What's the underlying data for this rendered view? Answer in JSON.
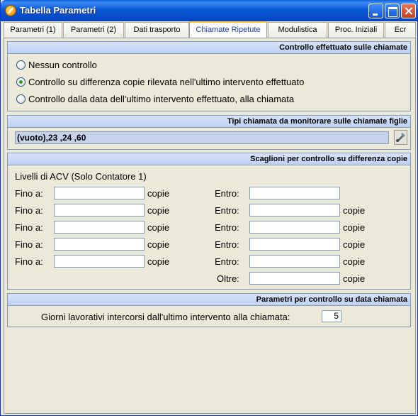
{
  "window": {
    "title": "Tabella Parametri"
  },
  "tabs": [
    "Parametri (1)",
    "Parametri (2)",
    "Dati trasporto",
    "Chiamate Ripetute",
    "Modulistica",
    "Proc. Iniziali",
    "Ecr"
  ],
  "controllo": {
    "header": "Controllo effettuato sulle chiamate",
    "options": [
      "Nessun controllo",
      "Controllo su differenza copie rilevata nell'ultimo intervento effettuato",
      "Controllo dalla data dell'ultimo intervento effettuato, alla chiamata"
    ],
    "selected_index": 1
  },
  "tipi": {
    "header": "Tipi chiamata da monitorare sulle chiamate figlie",
    "value": "(vuoto),23  ,24  ,60"
  },
  "scaglioni": {
    "header": "Scaglioni per controllo su differenza copie",
    "subtitle": "Livelli di ACV (Solo Contatore 1)",
    "fino_label": "Fino a:",
    "entro_label": "Entro:",
    "oltre_label": "Oltre:",
    "copie_label": "copie",
    "rows": [
      {
        "fino": "",
        "entro": ""
      },
      {
        "fino": "",
        "entro": ""
      },
      {
        "fino": "",
        "entro": ""
      },
      {
        "fino": "",
        "entro": ""
      },
      {
        "fino": "",
        "entro": ""
      }
    ],
    "oltre": ""
  },
  "data_chiamata": {
    "header": "Parametri per controllo su data chiamata",
    "label": "Giorni lavorativi intercorsi dall'ultimo intervento alla chiamata:",
    "value": "5"
  }
}
